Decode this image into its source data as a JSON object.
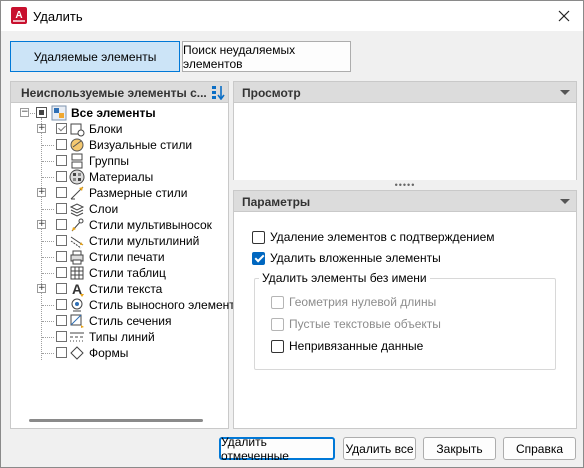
{
  "window": {
    "title": "Удалить"
  },
  "tabs": [
    {
      "label": "Удаляемые элементы",
      "active": true
    },
    {
      "label": "Поиск неудаляемых элементов",
      "active": false
    }
  ],
  "tree_panel": {
    "header": "Неиспользуемые элементы с...",
    "root_label": "Все элементы",
    "items": [
      {
        "label": "Блоки",
        "expandable": true,
        "checked": true,
        "icon": "block-icon"
      },
      {
        "label": "Визуальные стили",
        "expandable": false,
        "checked": false,
        "icon": "visual-style-icon"
      },
      {
        "label": "Группы",
        "expandable": false,
        "checked": false,
        "icon": "group-icon"
      },
      {
        "label": "Материалы",
        "expandable": false,
        "checked": false,
        "icon": "material-icon"
      },
      {
        "label": "Размерные стили",
        "expandable": true,
        "checked": false,
        "icon": "dimension-style-icon"
      },
      {
        "label": "Слои",
        "expandable": false,
        "checked": false,
        "icon": "layers-icon"
      },
      {
        "label": "Стили мультивыносок",
        "expandable": true,
        "checked": false,
        "icon": "multileader-style-icon"
      },
      {
        "label": "Стили мультилиний",
        "expandable": false,
        "checked": false,
        "icon": "multiline-style-icon"
      },
      {
        "label": "Стили печати",
        "expandable": false,
        "checked": false,
        "icon": "plot-style-icon"
      },
      {
        "label": "Стили таблиц",
        "expandable": false,
        "checked": false,
        "icon": "table-style-icon"
      },
      {
        "label": "Стили текста",
        "expandable": true,
        "checked": false,
        "icon": "text-style-icon"
      },
      {
        "label": "Стиль выносного элемента",
        "expandable": false,
        "checked": false,
        "icon": "detail-view-style-icon"
      },
      {
        "label": "Стиль сечения",
        "expandable": false,
        "checked": false,
        "icon": "section-view-style-icon"
      },
      {
        "label": "Типы линий",
        "expandable": false,
        "checked": false,
        "icon": "linetype-icon"
      },
      {
        "label": "Формы",
        "expandable": false,
        "checked": false,
        "icon": "shape-icon"
      }
    ]
  },
  "preview_panel": {
    "header": "Просмотр"
  },
  "params_panel": {
    "header": "Параметры",
    "confirm_label": "Удаление элементов с подтверждением",
    "nested_label": "Удалить вложенные элементы",
    "unnamed_group_title": "Удалить элементы без имени",
    "zero_length_label": "Геометрия нулевой длины",
    "empty_text_label": "Пустые текстовые объекты",
    "orphaned_label": "Непривязанные данные",
    "state": {
      "confirm": false,
      "nested": true,
      "zero_length": false,
      "empty_text": false,
      "orphaned": false
    }
  },
  "buttons": {
    "purge_checked": "Удалить отмеченные",
    "purge_all": "Удалить все",
    "close": "Закрыть",
    "help": "Справка"
  },
  "colors": {
    "accent": "#0078d7",
    "active_tab": "#cce4f7",
    "checkbox_checked": "#0067c0",
    "autocad_red": "#c8102e"
  }
}
